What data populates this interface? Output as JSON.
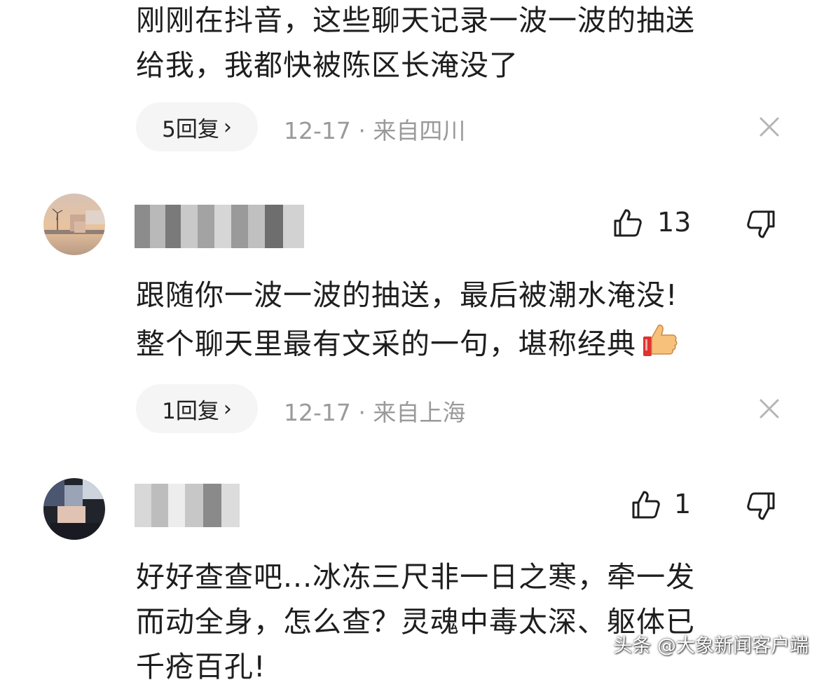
{
  "comment_top": {
    "lines": [
      "刚刚在抖音，这些聊天记录一波一波的抽送",
      "给我，我都快被陈区长淹没了"
    ],
    "replies_label": "5回复",
    "meta": "12-17 · 来自四川"
  },
  "comment_2": {
    "likes": "13",
    "lines": [
      "跟随你一波一波的抽送，最后被潮水淹没!",
      "整个聊天里最有文采的一句，堪称经典"
    ],
    "emoji": "thumbs-up-emoji",
    "replies_label": "1回复",
    "meta": "12-17 · 来自上海"
  },
  "comment_3": {
    "likes": "1",
    "lines": [
      "好好查查吧...冰冻三尺非一日之寒，牵一发",
      "而动全身，怎么查？灵魂中毒太深、躯体已",
      "千疮百孔!"
    ]
  },
  "watermark": "头条 @大象新闻客户端",
  "icons": {
    "like": "thumbs-up-icon",
    "dislike": "thumbs-down-icon",
    "close": "close-icon",
    "chevron": "chevron-right-icon"
  }
}
